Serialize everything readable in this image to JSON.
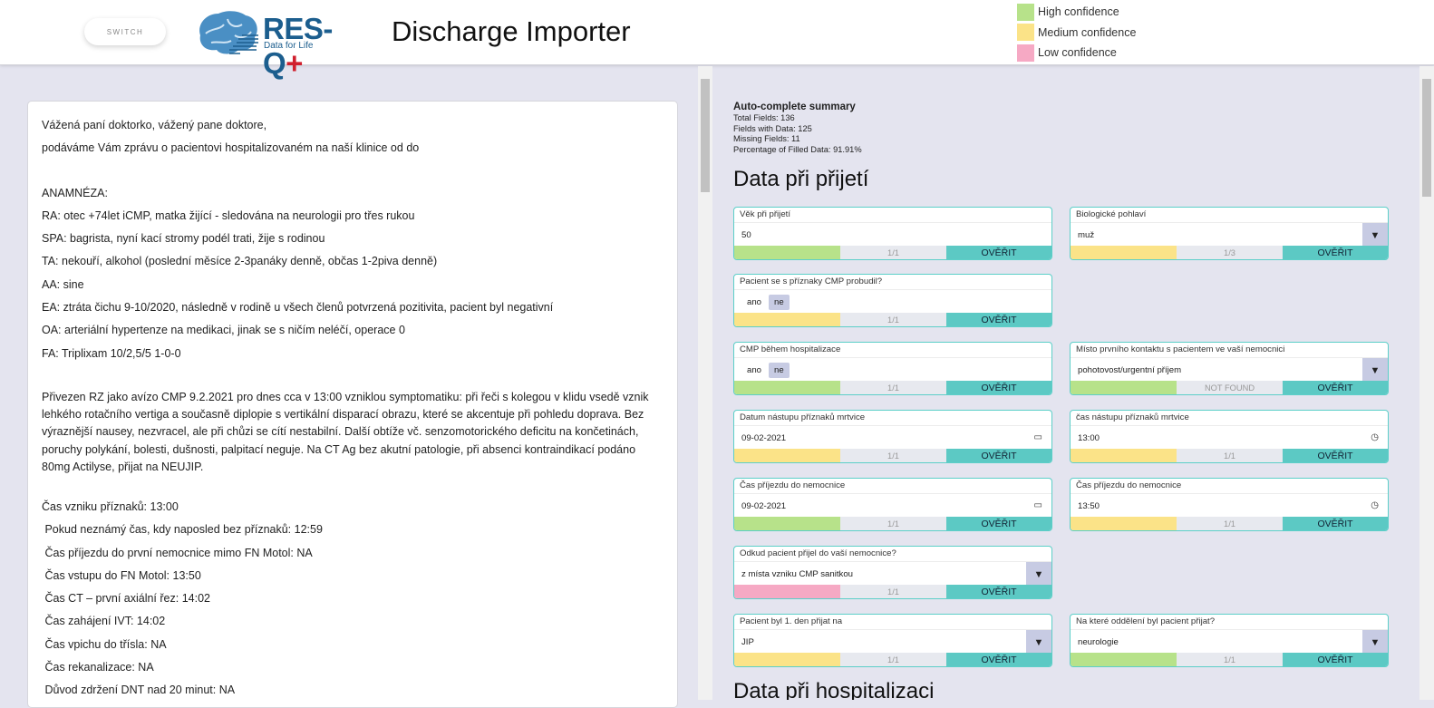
{
  "header": {
    "switch_label": "SWITCH",
    "logo_text": "RES-Q",
    "logo_plus": "+",
    "logo_sub": "Data for Life",
    "title": "Discharge Importer"
  },
  "legend": [
    {
      "label": "High confidence",
      "color": "#b7e28a"
    },
    {
      "label": "Medium confidence",
      "color": "#fbe388"
    },
    {
      "label": "Low confidence",
      "color": "#f6a9c4"
    }
  ],
  "document": {
    "lines_top": [
      "Vážená paní doktorko, vážený pane doktore,",
      "podáváme Vám zprávu o pacientovi hospitalizovaném na naší klinice od do"
    ],
    "history": [
      "ANAMNÉZA:",
      "RA: otec +74let iCMP, matka žijící - sledována na neurologii pro třes rukou",
      "SPA: bagrista, nyní kací stromy podél trati, žije s rodinou",
      "TA: nekouří, alkohol (poslední měsíce 2-3panáky denně, občas 1-2piva denně)",
      "AA: sine",
      "EA: ztráta čichu 9-10/2020, následně v rodině u všech členů potvrzená pozitivita, pacient byl negativní",
      "OA: arteriální hypertenze na medikaci, jinak se s ničím neléčí, operace 0",
      "FA: Triplixam 10/2,5/5 1-0-0"
    ],
    "paragraph": "Přivezen RZ jako avízo CMP 9.2.2021 pro dnes cca v 13:00 vzniklou symptomatiku: při řeči s kolegou v klidu vsedě vznik lehkého rotačního vertiga a současně diplopie s vertikální disparací obrazu, které se akcentuje při pohledu doprava. Bez výraznější nausey, nezvracel, ale při chůzi se cítí nestabilní. Další obtíže vč. senzomotorického deficitu na končetinách, poruchy polykání, bolesti, dušnosti, palpitací neguje. Na CT Ag bez akutní patologie, při absenci kontraindikací podáno 80mg Actilyse, přijat na NEUJIP.",
    "times": [
      "Čas vzniku příznaků: 13:00",
      " Pokud neznámý čas, kdy naposled bez příznaků: 12:59",
      " Čas příjezdu do první nemocnice mimo FN Motol: NA",
      " Čas vstupu do FN Motol: 13:50",
      " Čas CT – první axiální řez: 14:02",
      " Čas zahájení IVT: 14:02",
      " Čas vpichu do třísla: NA",
      " Čas rekanalizace: NA",
      " Důvod zdržení DNT nad 20 minut: NA"
    ]
  },
  "summary": {
    "title": "Auto-complete summary",
    "total": "Total Fields: 136",
    "with_data": "Fields with Data: 125",
    "missing": "Missing Fields: 11",
    "percentage": "Percentage of Filled Data: 91.91%"
  },
  "section1_title": "Data při přijetí",
  "section2_title": "Data při hospitalizaci",
  "verify_label": "OVĚŘIT",
  "fields": [
    {
      "label": "Věk při přijetí",
      "value": "50",
      "count": "1/1",
      "confidence": "#b7e28a",
      "kind": "text"
    },
    {
      "label": "Biologické pohlaví",
      "value": "muž",
      "count": "1/3",
      "confidence": "#fbe388",
      "kind": "select"
    },
    {
      "label": "Pacient se s příznaky CMP probudil?",
      "yes": "ano",
      "no": "ne",
      "count": "1/1",
      "confidence": "#fbe388",
      "kind": "yn"
    },
    {
      "label": "CMP během hospitalizace",
      "yes": "ano",
      "no": "ne",
      "count": "1/1",
      "confidence": "#b7e28a",
      "kind": "yn"
    },
    {
      "label": "Místo prvního kontaktu s pacientem ve vaší nemocnici",
      "value": "pohotovost/urgentní příjem",
      "count": "NOT FOUND",
      "confidence": "#b7e28a",
      "kind": "select"
    },
    {
      "label": "Datum nástupu příznaků mrtvice",
      "value": "09-02-2021",
      "count": "1/1",
      "confidence": "#fbe388",
      "kind": "date"
    },
    {
      "label": "čas nástupu příznaků mrtvice",
      "value": "13:00",
      "count": "1/1",
      "confidence": "#fbe388",
      "kind": "time"
    },
    {
      "label": "Čas příjezdu do nemocnice",
      "value": "09-02-2021",
      "count": "1/1",
      "confidence": "#b7e28a",
      "kind": "date"
    },
    {
      "label": "Čas příjezdu do nemocnice",
      "value": "13:50",
      "count": "1/1",
      "confidence": "#fbe388",
      "kind": "time"
    },
    {
      "label": "Odkud pacient přijel do vaší nemocnice?",
      "value": "z místa vzniku CMP sanitkou",
      "count": "1/1",
      "confidence": "#f6a9c4",
      "kind": "select"
    },
    {
      "label": "Pacient byl 1. den přijat na",
      "value": "JIP",
      "count": "1/1",
      "confidence": "#fbe388",
      "kind": "select"
    },
    {
      "label": "Na které oddělení byl pacient přijat?",
      "value": "neurologie",
      "count": "1/1",
      "confidence": "#b7e28a",
      "kind": "select"
    }
  ]
}
